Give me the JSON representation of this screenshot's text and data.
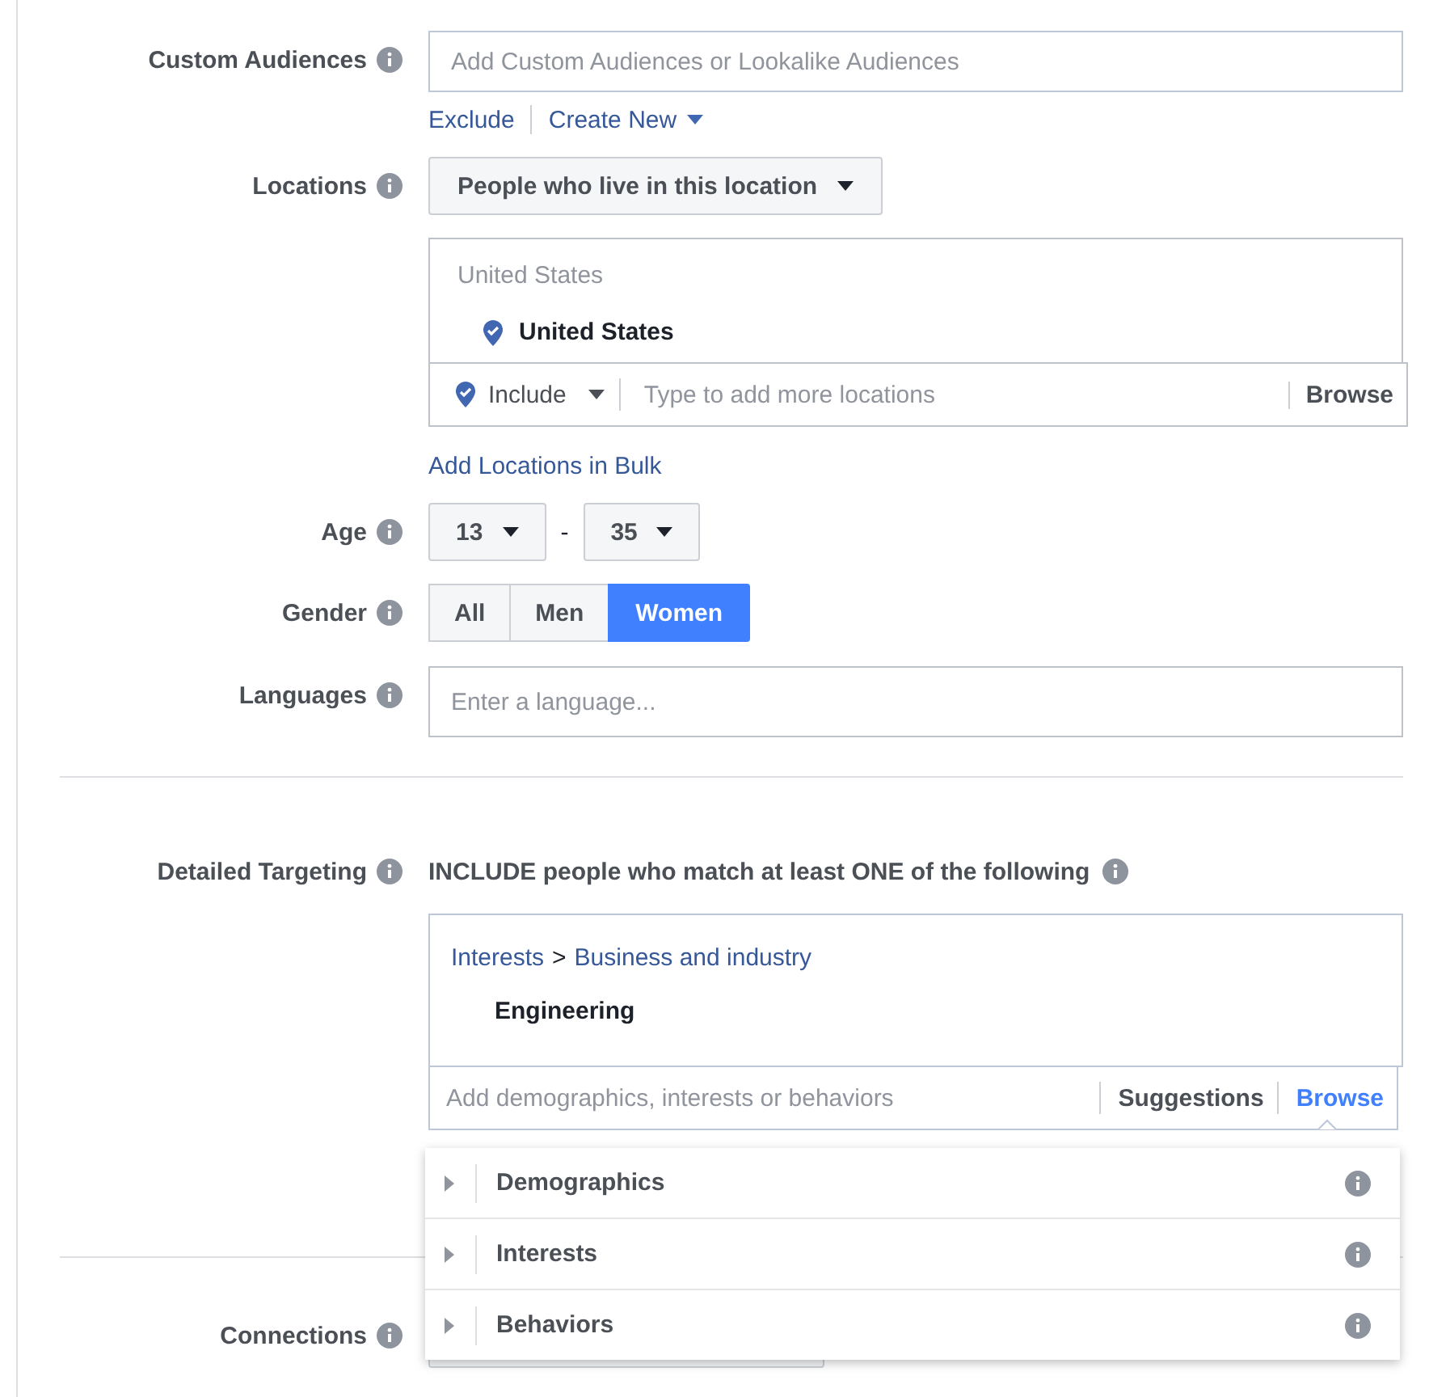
{
  "custom_audiences": {
    "label": "Custom Audiences",
    "placeholder": "Add Custom Audiences or Lookalike Audiences",
    "links": [
      "Exclude",
      "Create New"
    ]
  },
  "locations": {
    "label": "Locations",
    "dropdown": "People who live in this location",
    "group_title": "United States",
    "items": [
      "United States"
    ],
    "include_dropdown": "Include",
    "placeholder": "Type to add more locations",
    "browse": "Browse",
    "bulk_link": "Add Locations in Bulk"
  },
  "age": {
    "label": "Age",
    "min": "13",
    "separator": "-",
    "max": "35"
  },
  "gender": {
    "label": "Gender",
    "options": [
      {
        "label": "All",
        "selected": false
      },
      {
        "label": "Men",
        "selected": false
      },
      {
        "label": "Women",
        "selected": true
      }
    ]
  },
  "languages": {
    "label": "Languages",
    "placeholder": "Enter a language..."
  },
  "detailed_targeting": {
    "label": "Detailed Targeting",
    "heading_bold": "INCLUDE",
    "heading": "people who match at least ONE of the following",
    "path": [
      "Interests",
      "Business and industry"
    ],
    "path_separator": ">",
    "items": [
      "Engineering"
    ],
    "placeholder": "Add demographics, interests or behaviors",
    "tabs": [
      {
        "label": "Suggestions",
        "selected": false
      },
      {
        "label": "Browse",
        "selected": true
      }
    ],
    "menu": [
      {
        "label": "Demographics",
        "expanded": false
      },
      {
        "label": "Interests",
        "expanded": false
      },
      {
        "label": "Behaviors",
        "expanded": false
      }
    ]
  },
  "connections": {
    "label": "Connections"
  }
}
